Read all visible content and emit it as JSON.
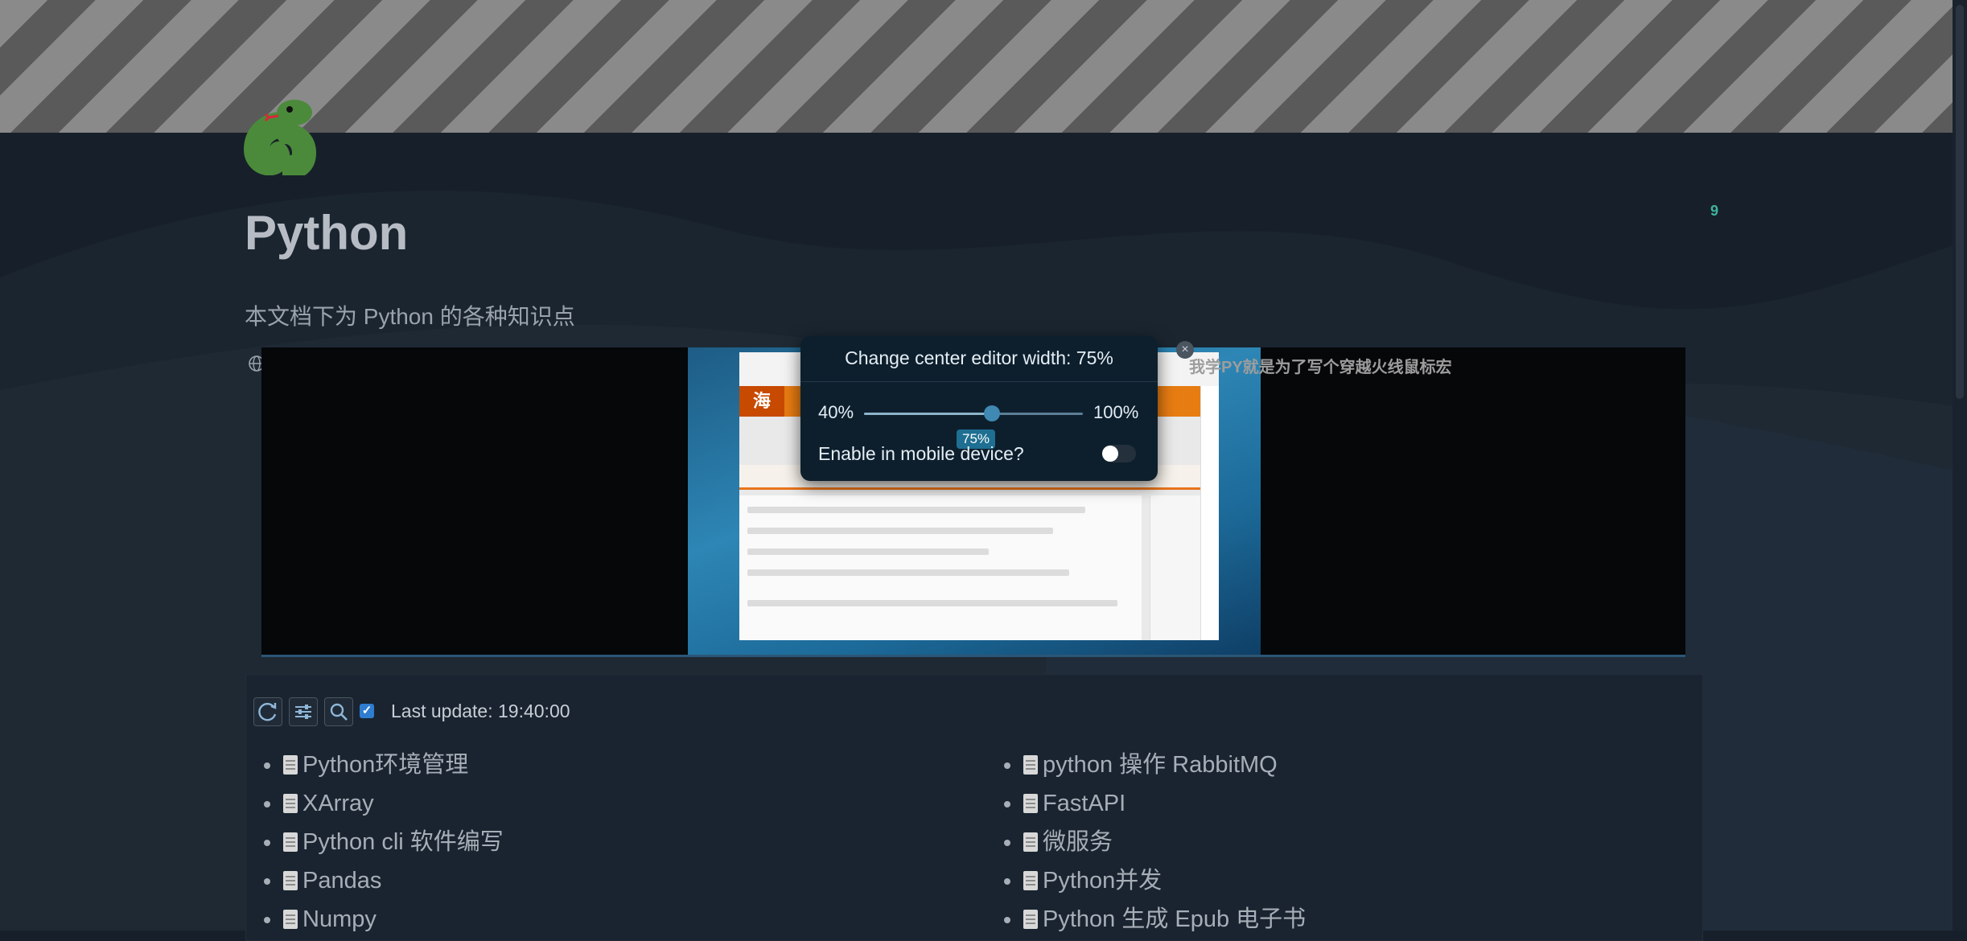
{
  "page": {
    "title": "Python",
    "subtitle": "本文档下为 Python 的各种知识点",
    "comment_count": "9"
  },
  "embed": {
    "caption": "我学PY就是为了写个穿越火线鼠标宏",
    "inner_logo": "海",
    "close_icon": "×"
  },
  "popup": {
    "title": "Change center editor width: 75%",
    "slider_min": "40%",
    "slider_max": "100%",
    "slider_value": 75,
    "slider_tooltip": "75%",
    "mobile_label": "Enable in mobile device?",
    "mobile_enabled": false
  },
  "panel": {
    "last_update": "Last update: 19:40:00",
    "checkbox_checked": true,
    "left_items": [
      "Python环境管理",
      "XArray",
      "Python cli 软件编写",
      "Pandas",
      "Numpy"
    ],
    "right_items": [
      "python 操作 RabbitMQ",
      "FastAPI",
      "微服务",
      "Python并发",
      "Python 生成 Epub 电子书"
    ]
  },
  "icons": {
    "page_icon": "python-snake-icon",
    "refresh": "refresh-icon",
    "settings": "sliders-icon",
    "search": "search-icon",
    "embed_handle": "globe-icon",
    "doc": "document-icon"
  }
}
